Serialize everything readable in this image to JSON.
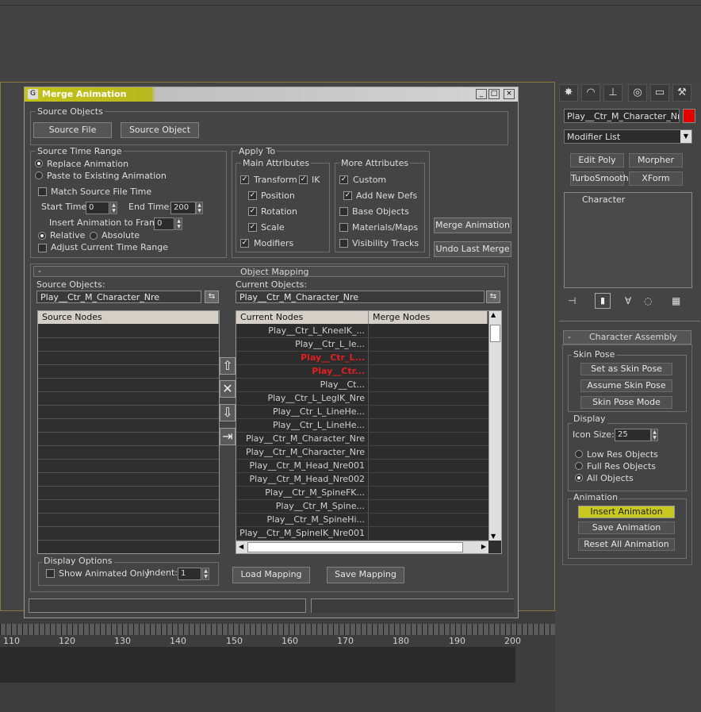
{
  "dialog": {
    "title": "Merge Animation",
    "win_buttons": [
      "_",
      "□",
      "×"
    ],
    "source_objects": {
      "label": "Source Objects",
      "source_file": "Source File",
      "source_object": "Source Object"
    },
    "source_time_range": {
      "label": "Source Time Range",
      "replace": "Replace Animation",
      "paste": "Paste to Existing Animation",
      "match_source": "Match Source File Time",
      "start_label": "Start Time:",
      "start_value": "0",
      "end_label": "End Time:",
      "end_value": "200",
      "insert_label": "Insert Animation to Frame:",
      "insert_value": "0",
      "relative": "Relative",
      "absolute": "Absolute",
      "adjust": "Adjust Current Time Range"
    },
    "apply_to": {
      "label": "Apply To",
      "main": {
        "label": "Main Attributes",
        "transform": "Transform",
        "ik": "IK",
        "position": "Position",
        "rotation": "Rotation",
        "scale": "Scale",
        "modifiers": "Modifiers"
      },
      "more": {
        "label": "More Attributes",
        "custom": "Custom",
        "add_new_defs": "Add New Defs",
        "base_objects": "Base Objects",
        "materials": "Materials/Maps",
        "visibility": "Visibility Tracks"
      }
    },
    "merge_animation_btn": "Merge Animation",
    "undo_last_merge_btn": "Undo Last Merge",
    "object_mapping": {
      "collapse": "-",
      "title": "Object Mapping",
      "source_objects_label": "Source Objects:",
      "source_objects_value": "Play__Ctr_M_Character_Nre",
      "current_objects_label": "Current Objects:",
      "current_objects_value": "Play__Ctr_M_Character_Nre",
      "source_nodes_header": "Source Nodes",
      "current_nodes_header": "Current Nodes",
      "merge_nodes_header": "Merge Nodes",
      "current_nodes": [
        {
          "name": "Play__Ctr_L_KneeIK_...",
          "red": false
        },
        {
          "name": "Play__Ctr_L_le...",
          "red": false
        },
        {
          "name": "Play__Ctr_L...",
          "red": true
        },
        {
          "name": "Play__Ctr...",
          "red": true
        },
        {
          "name": "Play__Ct...",
          "red": false
        },
        {
          "name": "Play__Ctr_L_LegIK_Nre",
          "red": false
        },
        {
          "name": "Play__Ctr_L_LineHe...",
          "red": false
        },
        {
          "name": "Play__Ctr_L_LineHe...",
          "red": false
        },
        {
          "name": "Play__Ctr_M_Character_Nre",
          "red": false
        },
        {
          "name": "Play__Ctr_M_Character_Nre",
          "red": false
        },
        {
          "name": "Play__Ctr_M_Head_Nre001",
          "red": false
        },
        {
          "name": "Play__Ctr_M_Head_Nre002",
          "red": false
        },
        {
          "name": "Play__Ctr_M_SpineFK...",
          "red": false
        },
        {
          "name": "Play__Ctr_M_Spine...",
          "red": false
        },
        {
          "name": "Play__Ctr_M_SpineHi...",
          "red": false
        },
        {
          "name": "Play__Ctr_M_SpineIK_Nre001",
          "red": false
        }
      ],
      "display_options": {
        "label": "Display Options",
        "show_animated": "Show Animated Only",
        "indent_label": "Indent:",
        "indent_value": "1"
      },
      "load_mapping": "Load Mapping",
      "save_mapping": "Save Mapping"
    }
  },
  "command_panel": {
    "object_name": "Play__Ctr_M_Character_Nre",
    "modifier_list": "Modifier List",
    "buttons": [
      "Edit Poly",
      "Morpher",
      "TurboSmooth",
      "XForm"
    ],
    "stack_item": "Character",
    "rollout": {
      "collapse": "-",
      "title": "Character Assembly",
      "skin_pose": {
        "label": "Skin Pose",
        "set": "Set as Skin Pose",
        "assume": "Assume Skin Pose",
        "mode": "Skin Pose Mode"
      },
      "display": {
        "label": "Display",
        "icon_size_label": "Icon Size:",
        "icon_size_value": "25",
        "low_res": "Low Res Objects",
        "full_res": "Full Res Objects",
        "all_objects": "All Objects"
      },
      "animation": {
        "label": "Animation",
        "insert": "Insert Animation",
        "save": "Save Animation",
        "reset": "Reset All Animation"
      }
    }
  },
  "timeline": {
    "ticks": [
      "110",
      "120",
      "130",
      "140",
      "150",
      "160",
      "170",
      "180",
      "190",
      "200"
    ]
  },
  "colors": {
    "highlight": "#c8c820",
    "red_node": "#e02020",
    "object_color": "#e00000"
  }
}
